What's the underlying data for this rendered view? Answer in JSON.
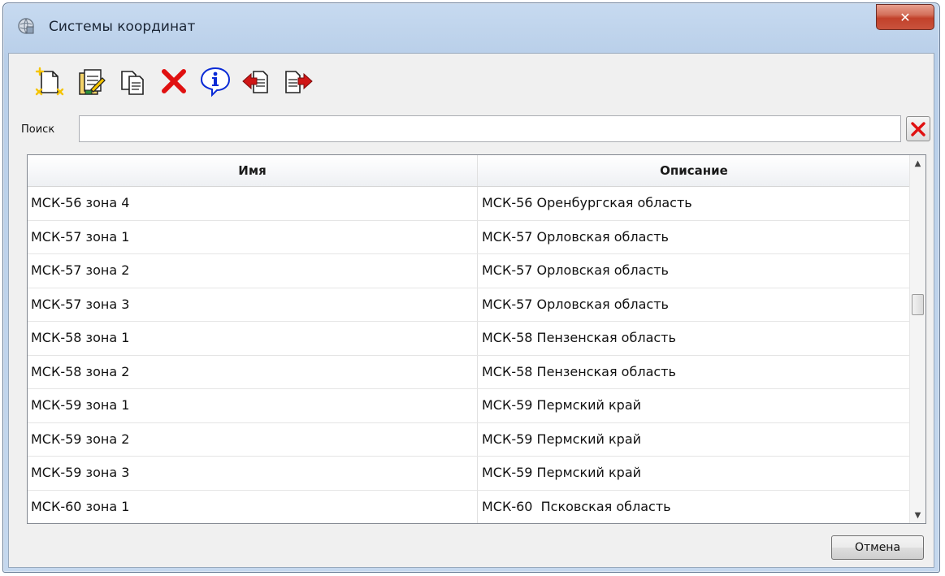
{
  "window": {
    "title": "Системы координат"
  },
  "toolbar": {
    "buttons": [
      {
        "icon": "new-document-icon"
      },
      {
        "icon": "edit-document-icon"
      },
      {
        "icon": "copy-icon"
      },
      {
        "icon": "delete-icon"
      },
      {
        "icon": "info-icon"
      },
      {
        "icon": "import-icon"
      },
      {
        "icon": "export-icon"
      }
    ]
  },
  "search": {
    "label": "Поиск",
    "value": ""
  },
  "table": {
    "columns": [
      "Имя",
      "Описание"
    ],
    "rows": [
      [
        "МСК-56 зона 4",
        "МСК-56 Оренбургская область"
      ],
      [
        "МСК-57 зона 1",
        "МСК-57 Орловская область"
      ],
      [
        "МСК-57 зона 2",
        "МСК-57 Орловская область"
      ],
      [
        "МСК-57 зона 3",
        "МСК-57 Орловская область"
      ],
      [
        "МСК-58 зона 1",
        "МСК-58 Пензенская область"
      ],
      [
        "МСК-58 зона 2",
        "МСК-58 Пензенская область"
      ],
      [
        "МСК-59 зона 1",
        "МСК-59 Пермский край"
      ],
      [
        "МСК-59 зона 2",
        "МСК-59 Пермский край"
      ],
      [
        "МСК-59 зона 3",
        "МСК-59 Пермский край"
      ],
      [
        "МСК-60 зона 1",
        "МСК-60  Псковская область"
      ]
    ]
  },
  "footer": {
    "cancel_label": "Отмена"
  },
  "colors": {
    "delete_red": "#e01010",
    "info_blue": "#0a2bd6",
    "accent_yellow": "#f5c400"
  }
}
